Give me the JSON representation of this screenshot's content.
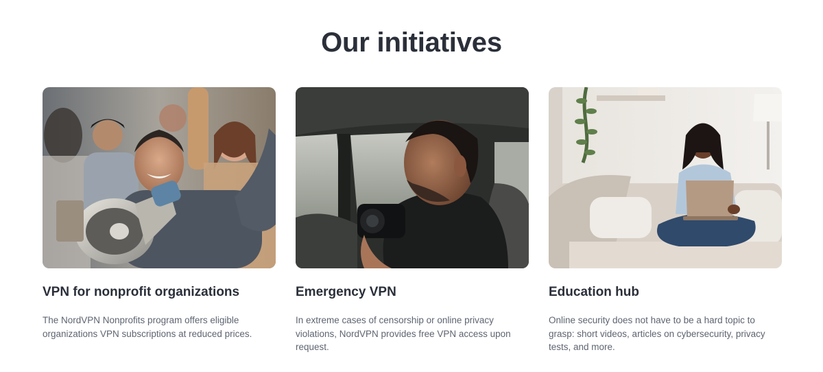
{
  "section": {
    "title": "Our initiatives"
  },
  "initiatives": [
    {
      "title": "VPN for nonprofit organizations",
      "description": "The NordVPN Nonprofits program offers eligible organizations VPN subscriptions at reduced prices."
    },
    {
      "title": "Emergency VPN",
      "description": "In extreme cases of censorship or online privacy violations, NordVPN provides free VPN access upon request."
    },
    {
      "title": "Education hub",
      "description": "Online security does not have to be a hard topic to grasp: short videos, articles on cybersecurity, privacy tests, and more."
    }
  ]
}
